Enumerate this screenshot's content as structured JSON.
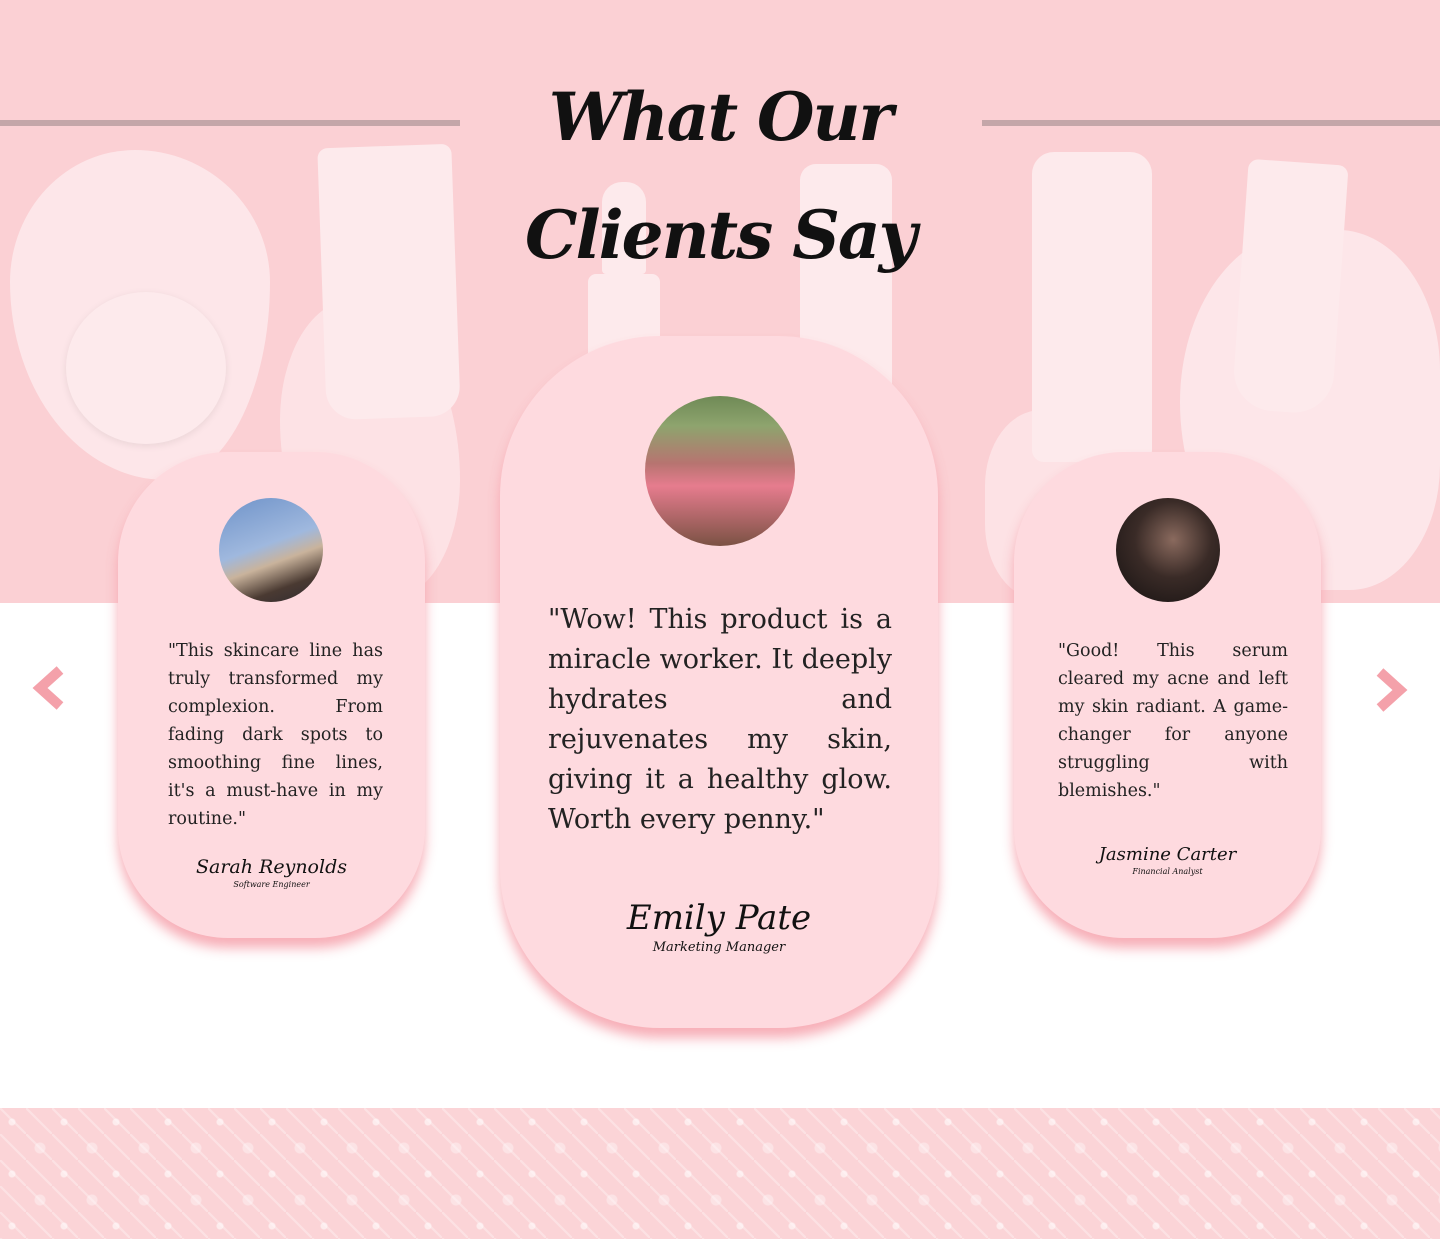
{
  "header": {
    "title": "What Our Clients Say"
  },
  "testimonials": [
    {
      "position": "left",
      "quote": "\"This skincare line has truly transformed my complexion. From fading dark spots to smoothing fine lines, it's a must-have in my routine.\"",
      "name": "Sarah Reynolds",
      "role": "Software Engineer"
    },
    {
      "position": "center",
      "quote": "\"Wow! This product is a miracle worker. It deeply hydrates and rejuvenates my skin, giving it a healthy glow. Worth every penny.\"",
      "name": "Emily Pate",
      "role": "Marketing Manager"
    },
    {
      "position": "right",
      "quote": "\"Good! This serum cleared my acne and left my skin radiant. A game-changer for anyone struggling with blemishes.\"",
      "name": "Jasmine Carter",
      "role": "Financial Analyst"
    }
  ],
  "navigation": {
    "prev_icon": "chevron-left-icon",
    "next_icon": "chevron-right-icon"
  },
  "colors": {
    "hero_background": "#fbd0d4",
    "card_background": "#fedadf",
    "card_shadow": "#f6a0aa",
    "arrow": "#f4a1aa",
    "divider": "#c4a6a9"
  }
}
